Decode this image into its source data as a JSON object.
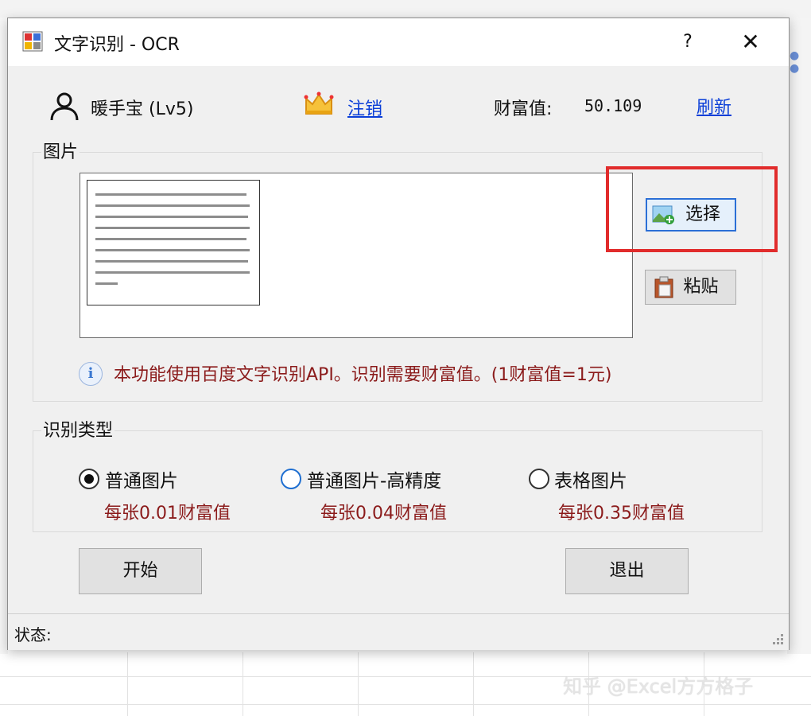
{
  "dialog": {
    "title": "文字识别 - OCR",
    "help_label": "?",
    "close_label": "✕"
  },
  "user": {
    "name": "暖手宝 (Lv5)",
    "logout_label": "注销",
    "wealth_label": "财富值:",
    "wealth_value": "50.109",
    "refresh_label": "刷新"
  },
  "image_group": {
    "label": "图片",
    "select_label": "选择",
    "paste_label": "粘贴",
    "info_text": "本功能使用百度文字识别API。识别需要财富值。(1财富值=1元)"
  },
  "type_group": {
    "label": "识别类型",
    "options": [
      {
        "label": "普通图片",
        "cost": "每张0.01财富值",
        "checked": true
      },
      {
        "label": "普通图片-高精度",
        "cost": "每张0.04财富值",
        "checked": false
      },
      {
        "label": "表格图片",
        "cost": "每张0.35财富值",
        "checked": false
      }
    ]
  },
  "actions": {
    "start_label": "开始",
    "exit_label": "退出"
  },
  "status": {
    "label": "状态:"
  },
  "watermark": "知乎 @Excel方方格子",
  "colors": {
    "accent": "#2b6fd6",
    "link": "#0b3fd8",
    "note_red": "#8b1b1b",
    "annotation_red": "#e12c2c"
  }
}
